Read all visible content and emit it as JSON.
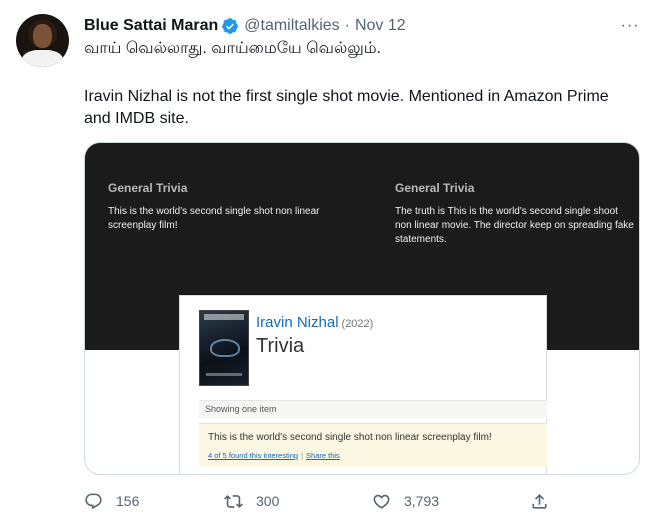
{
  "tweet": {
    "author_name": "Blue Sattai Maran",
    "handle": "@tamiltalkies",
    "separator": "·",
    "date": "Nov 12",
    "more_label": "···",
    "text_tamil": "வாய் வெல்லாது. வாய்மையே வெல்லும்.",
    "text_line1": "Iravin Nizhal is not the first single shot movie. Mentioned in Amazon Prime",
    "text_line2": "and IMDB site."
  },
  "media": {
    "left_trivia": {
      "title": "General Trivia",
      "body": "This is the world's second single shot non linear screenplay film!"
    },
    "right_trivia": {
      "title": "General Trivia",
      "body": "The truth is This is the world's second single shoot non linear movie. The director keep on spreading fake statements."
    },
    "imdb": {
      "movie_title": "Iravin Nizhal",
      "year": "(2022)",
      "heading": "Trivia",
      "showing": "Showing one item",
      "item_text": "This is the world's second single shot non linear screenplay film!",
      "interesting_link": "4 of 5 found this interesting",
      "link_sep": "|",
      "share_link": "Share this"
    }
  },
  "actions": {
    "reply_count": "156",
    "retweet_count": "300",
    "like_count": "3,793"
  },
  "colors": {
    "accent": "#1d9bf0",
    "muted": "#536471",
    "imdb_link": "#136cb2"
  }
}
